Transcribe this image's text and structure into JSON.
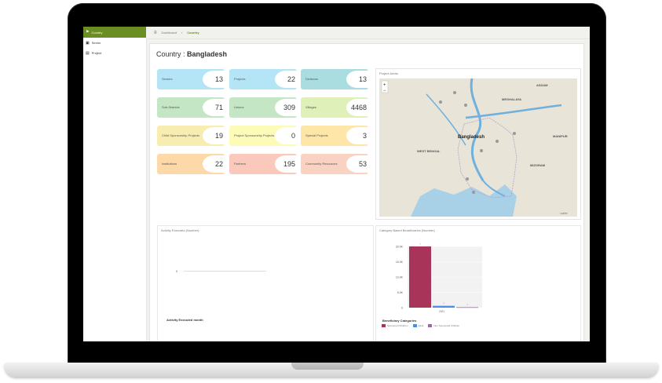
{
  "sidebar": {
    "items": [
      {
        "label": "Country",
        "active": true
      },
      {
        "label": "Sector"
      },
      {
        "label": "Project"
      }
    ]
  },
  "breadcrumb": {
    "home": "Dashboard",
    "separator": "/",
    "current": "Country"
  },
  "page": {
    "title_prefix": "Country :",
    "country": "Bangladesh"
  },
  "stats": [
    {
      "label": "Sectors",
      "value": "13",
      "color": "#b3e5f7"
    },
    {
      "label": "Projects",
      "value": "22",
      "color": "#b3e5f7"
    },
    {
      "label": "Divisions",
      "value": "13",
      "color": "#a9dde0"
    },
    {
      "label": "Sub-Districts",
      "value": "71",
      "color": "#c4e6c4"
    },
    {
      "label": "Unions",
      "value": "309",
      "color": "#c4e6c4"
    },
    {
      "label": "Villages",
      "value": "4468",
      "color": "#dff0b8"
    },
    {
      "label": "Child Sponsorship Projects",
      "value": "19",
      "color": "#f8edb0"
    },
    {
      "label": "Project Sponsorship Projects",
      "value": "0",
      "color": "#fdfbb8"
    },
    {
      "label": "Special Projects",
      "value": "3",
      "color": "#fde6a8"
    },
    {
      "label": "Institutions",
      "value": "22",
      "color": "#fdd8a8"
    },
    {
      "label": "Partners",
      "value": "195",
      "color": "#fbc9bb"
    },
    {
      "label": "Community Resources",
      "value": "53",
      "color": "#f9d2c2"
    }
  ],
  "map": {
    "title": "Project Areas",
    "labels": {
      "country": "Bangladesh",
      "west_bengal": "WEST BENGAL",
      "meghalaya": "MEGHALAYA",
      "assam": "ASSAM",
      "manipur": "MANIPUR",
      "mizoram": "MIZORAM"
    },
    "zoom_in": "+",
    "zoom_out": "−",
    "attribution": "Leaflet",
    "land_color": "#e9e4d8",
    "water_color": "#a8d0e6",
    "river_color": "#6fb0dd"
  },
  "activity": {
    "title": "Activity Executed (Number)",
    "zero_label": "0",
    "footer": "Activity Executed month"
  },
  "beneficiary": {
    "title": "Category Based Beneficiaries (Number)",
    "footer": "Beneficiary Categories",
    "legend": [
      {
        "name": "Sponsored Children",
        "color": "#a8345a"
      },
      {
        "name": "Adult",
        "color": "#4a90e2"
      },
      {
        "name": "Non Sponsored Children",
        "color": "#b15bb3"
      }
    ]
  },
  "chart_data": {
    "type": "bar",
    "title": "Category Based Beneficiaries (Number)",
    "xlabel": "",
    "ylabel": "",
    "categories": [
      "2021"
    ],
    "ylim": [
      0,
      20000
    ],
    "ytick_labels": [
      "0",
      "5.0K",
      "10.0K",
      "15.0K",
      "20.0K"
    ],
    "ytick_values": [
      0,
      5000,
      10000,
      15000,
      20000
    ],
    "series": [
      {
        "name": "Sponsored Children",
        "values": [
          21000
        ],
        "color": "#a8345a"
      },
      {
        "name": "Adult",
        "values": [
          600
        ],
        "color": "#4a90e2"
      },
      {
        "name": "Non Sponsored Children",
        "values": [
          150
        ],
        "color": "#b15bb3"
      }
    ]
  }
}
